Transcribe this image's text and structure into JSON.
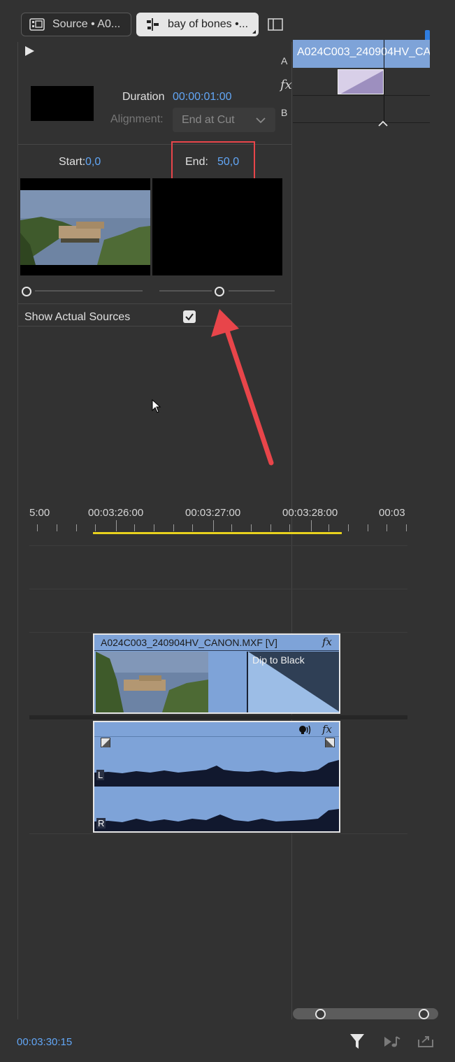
{
  "tabs": {
    "source_label": "Source • A0...",
    "effects_label": "bay of bones •..."
  },
  "effect_controls": {
    "duration_label": "Duration",
    "duration_value": "00:00:01:00",
    "alignment_label": "Alignment:",
    "alignment_value": "End at Cut",
    "start_label": "Start:",
    "start_value": "0,0",
    "end_label": "End:",
    "end_value": "50,0",
    "show_actual_sources_label": "Show Actual Sources",
    "show_actual_sources_checked": true
  },
  "mini_timeline": {
    "track_a_label": "A",
    "track_b_label": "B",
    "fx_label": "fx",
    "clip_name": "A024C003_240904HV_CA"
  },
  "timeline": {
    "ruler_labels": [
      "5:00",
      "00:03:26:00",
      "00:03:27:00",
      "00:03:28:00",
      "00:03"
    ],
    "video_clip_name": "A024C003_240904HV_CANON.MXF [V]",
    "video_fx_label": "fx",
    "transition_label": "Dip to Black",
    "audio_fx_label": "fx",
    "audio_channel_left": "L",
    "audio_channel_right": "R"
  },
  "footer": {
    "timecode": "00:03:30:15"
  },
  "colors": {
    "accent_blue": "#62a6f5",
    "clip_blue": "#7ea3d8",
    "highlight_red": "#e8454a",
    "work_area_yellow": "#e8d21e"
  }
}
